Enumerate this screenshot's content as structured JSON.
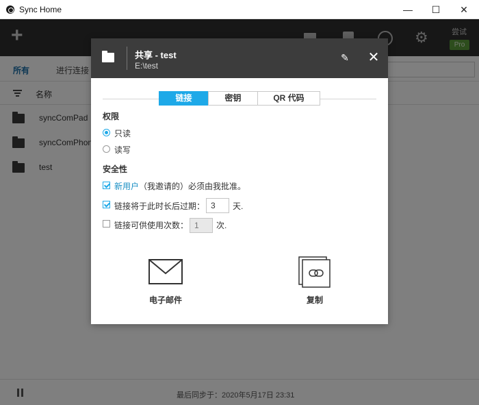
{
  "window": {
    "title": "Sync Home",
    "min_glyph": "—",
    "max_glyph": "☐",
    "close_glyph": "✕"
  },
  "toolbar": {
    "add_glyph": "+",
    "gear_glyph": "⚙",
    "trial_label": "尝试",
    "pro_badge": "Pro"
  },
  "filters": {
    "all": "所有",
    "connecting": "进行连接"
  },
  "list": {
    "header_name": "名称",
    "items": [
      "syncComPad",
      "syncComPhone",
      "test"
    ]
  },
  "status": {
    "last_sync": "最后同步于：2020年5月17日 23:31"
  },
  "dialog": {
    "title": "共享 - test",
    "path": "E:\\test",
    "edit_glyph": "✎",
    "close_glyph": "✕",
    "tabs": [
      "链接",
      "密钥",
      "QR 代码"
    ],
    "active_tab": "链接",
    "permissions_label": "权限",
    "perm_readonly": "只读",
    "perm_readwrite": "读写",
    "security_label": "安全性",
    "opt_new_user_hl": "新用户",
    "opt_new_user_rest": "（我邀请的）必须由我批准。",
    "opt_expire": "链接将于此时长后过期：",
    "expire_value": "3",
    "expire_unit": "天.",
    "opt_uses": "链接可供使用次数：",
    "uses_value": "1",
    "uses_unit": "次.",
    "action_email": "电子邮件",
    "action_copy": "复制",
    "accent_color": "#1ea9e8"
  }
}
